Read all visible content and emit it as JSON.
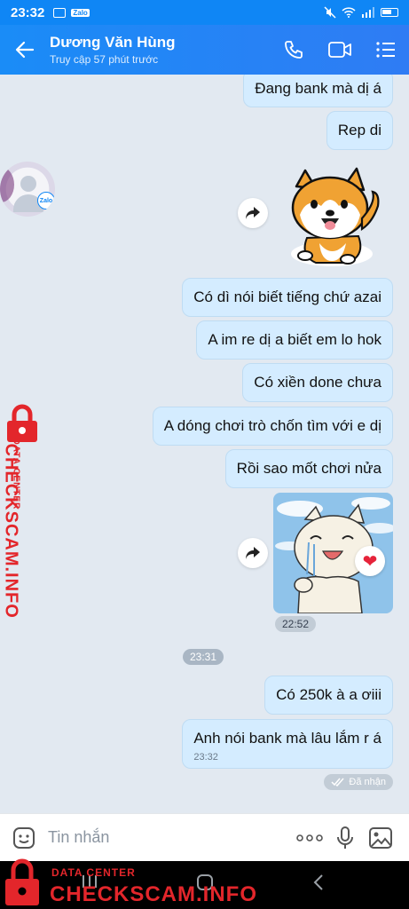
{
  "status_bar": {
    "time": "23:32",
    "app_badge": "Zalo"
  },
  "header": {
    "title": "Dương Văn Hùng",
    "subtitle": "Truy cập 57 phút trước"
  },
  "avatar_badge": "Zalo",
  "messages": [
    {
      "text": "Đang bank mà dị á"
    },
    {
      "text": "Rep di"
    },
    {
      "text": "Có dì nói biết tiếng chứ azai"
    },
    {
      "text": "A im re dị a biết em lo hok"
    },
    {
      "text": "Có xiền done chưa"
    },
    {
      "text": "A dóng chơi trò chốn tìm với e dị"
    },
    {
      "text": "Rồi sao mốt chơi nửa"
    },
    {
      "text": "Có 250k à a ơiii"
    },
    {
      "text": "Anh nói bank mà lâu lắm r á",
      "time": "23:32"
    }
  ],
  "sticker_time": "22:52",
  "divider_time": "23:31",
  "delivered_status": "Đã nhận",
  "input": {
    "placeholder": "Tin nhắn"
  },
  "watermark": {
    "sub": "DATA CENTER",
    "main": "CHECKSCAM.INFO"
  },
  "colors": {
    "header_blue": "#1a8cf7",
    "bubble": "#d4ecff",
    "chat_bg": "#e2e9f1",
    "watermark_red": "#e3262b"
  }
}
